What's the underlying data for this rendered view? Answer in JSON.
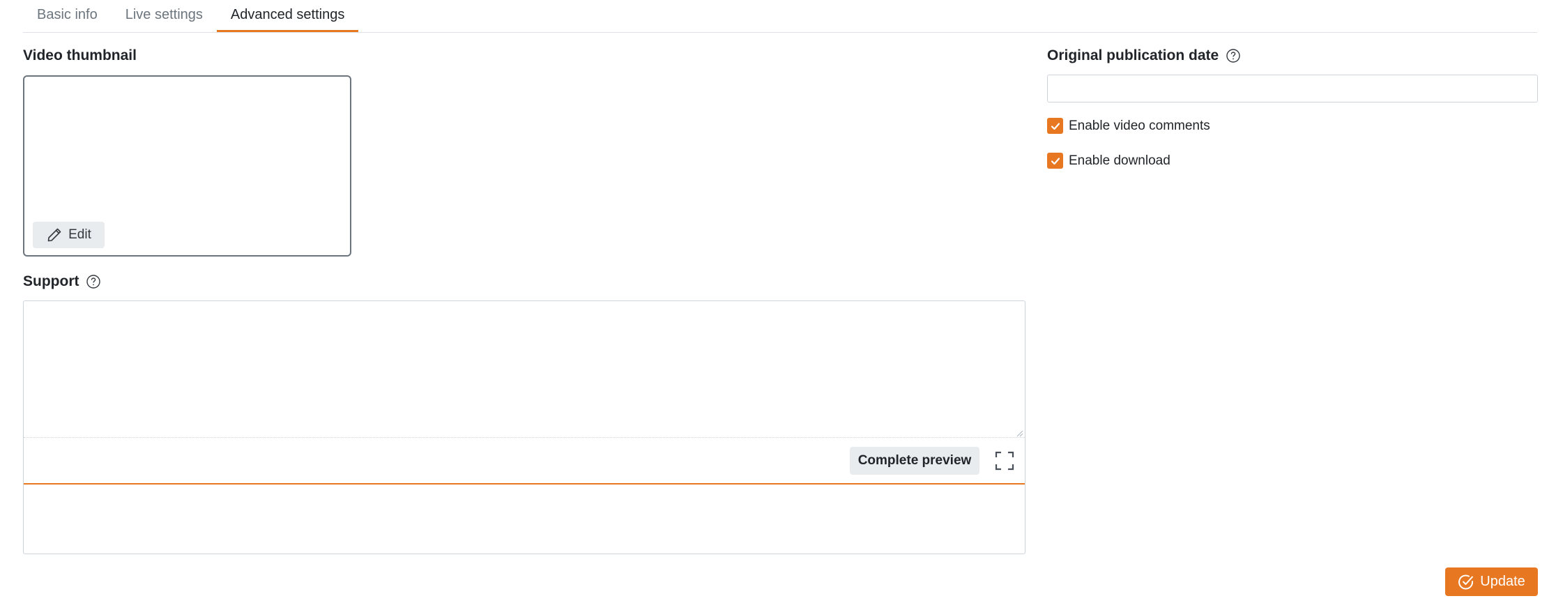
{
  "tabs": [
    {
      "label": "Basic info",
      "active": false
    },
    {
      "label": "Live settings",
      "active": false
    },
    {
      "label": "Advanced settings",
      "active": true
    }
  ],
  "thumbnail": {
    "label": "Video thumbnail",
    "edit_label": "Edit",
    "edit_icon": "pencil-icon"
  },
  "support": {
    "label": "Support",
    "help_icon": "question-circle-icon",
    "textarea_value": "",
    "preview_label": "Complete preview",
    "fullscreen_icon": "fullscreen-icon"
  },
  "publication_date": {
    "label": "Original publication date",
    "help_icon": "question-circle-icon",
    "value": ""
  },
  "options": {
    "comments": {
      "label": "Enable video comments",
      "checked": true
    },
    "download": {
      "label": "Enable download",
      "checked": true
    }
  },
  "actions": {
    "update_label": "Update",
    "update_icon": "check-circle-icon"
  },
  "colors": {
    "accent": "#e87722",
    "tab_inactive": "#6c757d",
    "text": "#212529"
  }
}
